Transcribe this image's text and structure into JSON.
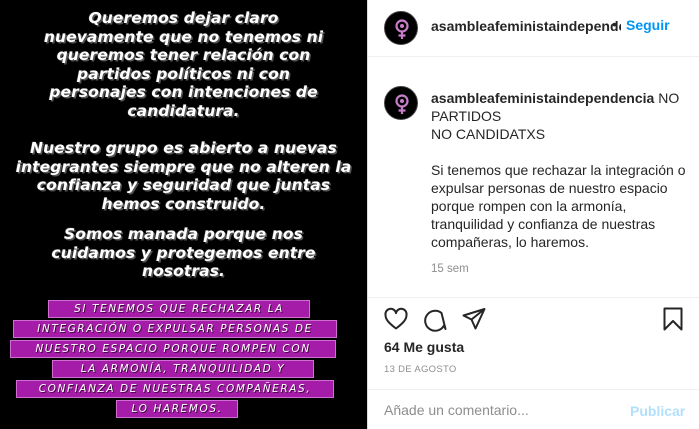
{
  "image": {
    "paragraphs": [
      "Queremos dejar claro\nnuevamente que no tenemos ni\nqueremos tener relación con\npartidos políticos ni con\npersonajes con intenciones de\ncandidatura.",
      "Nuestro grupo es abierto a nuevas\nintegrantes siempre que no alteren la\nconfianza y seguridad que juntas\nhemos construido.",
      "Somos manada porque nos\ncuidamos y protegemos entre\nnosotras."
    ],
    "highlight_lines": [
      "SI TENEMOS QUE RECHAZAR LA",
      "INTEGRACIÓN O EXPULSAR PERSONAS DE",
      "NUESTRO ESPACIO PORQUE ROMPEN CON",
      "LA ARMONÍA, TRANQUILIDAD Y",
      "CONFIANZA DE NUESTRAS COMPAÑERAS,",
      "LO HAREMOS."
    ],
    "highlight_color": "#a51ca8"
  },
  "header": {
    "username": "asambleafeministaindependencia",
    "dot": "•",
    "follow_label": "Seguir"
  },
  "caption": {
    "username": "asambleafeministaindependencia",
    "first_word": "NO",
    "body": "PARTIDOS\nNO CANDIDATXS\n\nSi tenemos que rechazar la integración o expulsar personas de nuestro espacio porque rompen con la armonía, tranquilidad y confianza de nuestras compañeras, lo haremos.",
    "time": "15 sem"
  },
  "actions": {
    "icons": [
      "heart-icon",
      "comment-icon",
      "share-icon",
      "bookmark-icon"
    ]
  },
  "likes": "64 Me gusta",
  "date": "13 DE AGOSTO",
  "comment": {
    "placeholder": "Añade un comentario...",
    "publish_label": "Publicar"
  },
  "colors": {
    "accent": "#0095f6",
    "publish_disabled": "#b2dffc",
    "avatar_symbol": "#c77dca"
  }
}
